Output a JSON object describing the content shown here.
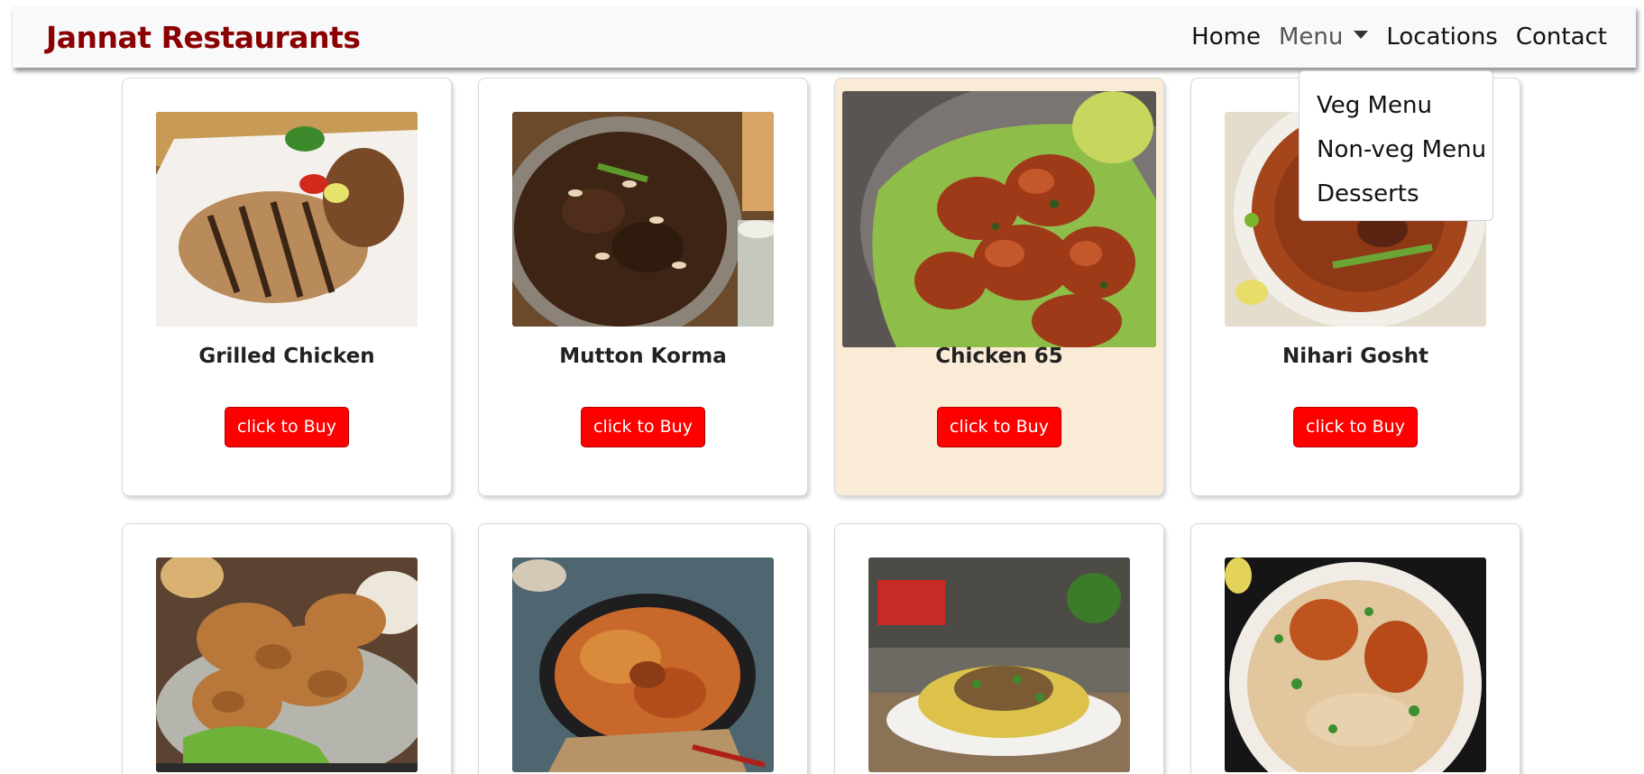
{
  "brand": "Jannat Restaurants",
  "nav": {
    "home": "Home",
    "menu": "Menu",
    "locations": "Locations",
    "contact": "Contact"
  },
  "dropdown": {
    "items": [
      "Veg Menu",
      "Non-veg Menu",
      "Desserts"
    ]
  },
  "cards": [
    {
      "title": "Grilled Chicken",
      "button": "click to Buy",
      "image": "grilled-chicken-photo"
    },
    {
      "title": "Mutton Korma",
      "button": "click to Buy",
      "image": "mutton-korma-photo"
    },
    {
      "title": "Chicken 65",
      "button": "click to Buy",
      "image": "chicken-65-photo"
    },
    {
      "title": "Nihari Gosht",
      "button": "click to Buy",
      "image": "nihari-gosht-photo"
    },
    {
      "title": "",
      "button": "",
      "image": "fried-chicken-photo"
    },
    {
      "title": "",
      "button": "",
      "image": "biryani-pan-photo"
    },
    {
      "title": "",
      "button": "",
      "image": "biryani-plate-photo"
    },
    {
      "title": "",
      "button": "",
      "image": "chicken-biryani-photo"
    }
  ],
  "colors": {
    "brand": "#8b0000",
    "button": "#ff0000",
    "hover_card": "#faebd7",
    "navbar_bg": "#f8f9fa"
  }
}
